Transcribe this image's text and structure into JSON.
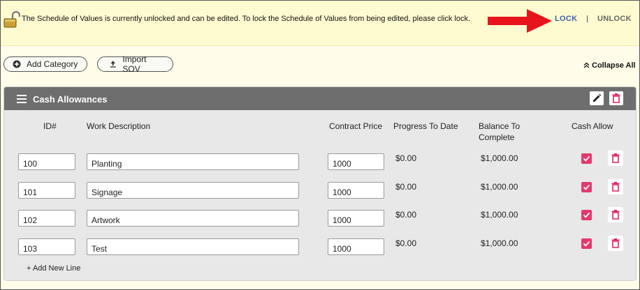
{
  "banner": {
    "message": "The Schedule of Values is currently unlocked and can be edited. To lock the Schedule of Values from being edited, please click lock.",
    "lock_label": "LOCK",
    "separator": "|",
    "unlock_label": "UNLOCK"
  },
  "toolbar": {
    "add_category_label": "Add Category",
    "import_sov_label": "Import SOV",
    "collapse_all_label": "Collapse All"
  },
  "section": {
    "title": "Cash Allowances",
    "columns": {
      "id": "ID#",
      "description": "Work Description",
      "contract_price": "Contract Price",
      "progress": "Progress To Date",
      "balance_line1": "Balance To",
      "balance_line2": "Complete",
      "cash_allow": "Cash Allow"
    },
    "rows": [
      {
        "id": "100",
        "description": "Planting",
        "price": "1000",
        "progress": "$0.00",
        "balance": "$1,000.00",
        "cash_allow": true
      },
      {
        "id": "101",
        "description": "Signage",
        "price": "1000",
        "progress": "$0.00",
        "balance": "$1,000.00",
        "cash_allow": true
      },
      {
        "id": "102",
        "description": "Artwork",
        "price": "1000",
        "progress": "$0.00",
        "balance": "$1,000.00",
        "cash_allow": true
      },
      {
        "id": "103",
        "description": "Test",
        "price": "1000",
        "progress": "$0.00",
        "balance": "$1,000.00",
        "cash_allow": true
      }
    ],
    "add_line_label": "+ Add New Line"
  },
  "colors": {
    "banner_bg": "#fffbd1",
    "header_bg": "#6e6e6e",
    "checkbox": "#e23a6e",
    "delete": "#e0245e",
    "lock_link": "#3b5fa8",
    "arrow": "#e8141b"
  },
  "icons": {
    "lock": "unlocked-padlock-icon",
    "arrow": "red-pointer-arrow-icon",
    "add_category": "plus-circle-icon",
    "import": "upload-icon",
    "collapse": "double-chevron-up-icon",
    "menu": "hamburger-icon",
    "edit": "pencil-icon",
    "delete": "trash-icon",
    "check": "checkbox-checked-icon"
  }
}
